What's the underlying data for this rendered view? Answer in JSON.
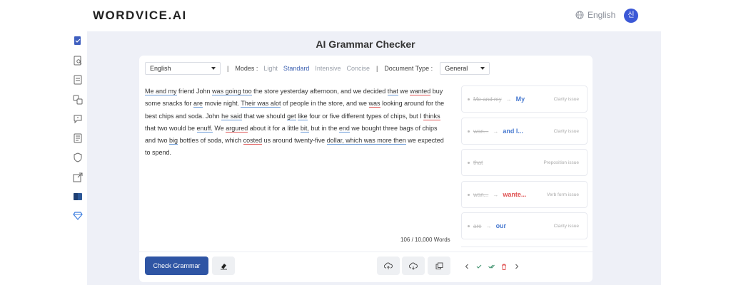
{
  "header": {
    "logo": "WORDVICE.AI",
    "language": "English",
    "avatar_initial": "신"
  },
  "sidebar": {
    "icons": [
      "document-check-icon",
      "search-document-icon",
      "list-icon",
      "translate-icon",
      "chat-icon",
      "summary-icon",
      "shield-icon",
      "export-icon",
      "word-icon",
      "diamond-icon"
    ]
  },
  "main": {
    "title": "AI Grammar Checker",
    "toolbar": {
      "language_value": "English",
      "modes_label": "Modes :",
      "modes": [
        "Light",
        "Standard",
        "Intensive",
        "Concise"
      ],
      "active_mode": "Standard",
      "document_type_label": "Document Type :",
      "document_type_value": "General"
    },
    "word_count": "106 / 10,000 Words",
    "check_button": "Check Grammar"
  },
  "suggestions": [
    {
      "original": "Me and my",
      "fix": "My",
      "issue": "Clarity issue",
      "fix_color": "#4a7bd0"
    },
    {
      "original": "wan...",
      "fix": "and I...",
      "issue": "Clarity issue",
      "fix_color": "#4a7bd0"
    },
    {
      "original": "that",
      "fix": "",
      "issue": "Preposition issue",
      "fix_color": "#4a7bd0"
    },
    {
      "original": "wan...",
      "fix": "wante...",
      "issue": "Verb form issue",
      "fix_color": "#e05252"
    },
    {
      "original": "are",
      "fix": "our",
      "issue": "Clarity issue",
      "fix_color": "#4a7bd0"
    }
  ],
  "colors": {
    "accent": "#2f55a4",
    "workspace_bg": "#eef0f7",
    "underline_blue": "#6b9bd8",
    "underline_red": "#e05a5a"
  }
}
